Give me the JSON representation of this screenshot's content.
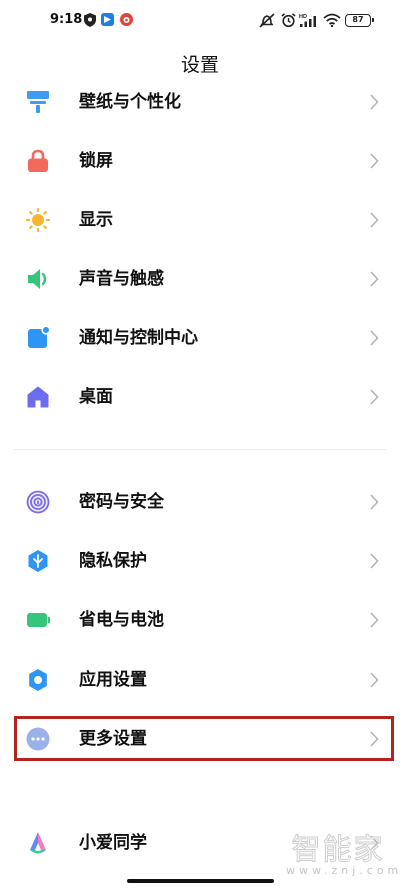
{
  "status_bar": {
    "time": "9:18",
    "network_label": "HD",
    "battery": "87"
  },
  "header": {
    "title": "设置"
  },
  "settings": {
    "items": [
      {
        "label": "壁纸与个性化",
        "icon": "wallpaper-icon",
        "color": "#3D9BF0"
      },
      {
        "label": "锁屏",
        "icon": "lock-icon",
        "color": "#F26A5B"
      },
      {
        "label": "显示",
        "icon": "sun-icon",
        "color": "#F5B731"
      },
      {
        "label": "声音与触感",
        "icon": "speaker-icon",
        "color": "#34C77B"
      },
      {
        "label": "通知与控制中心",
        "icon": "notification-icon",
        "color": "#2F95F2"
      },
      {
        "label": "桌面",
        "icon": "home-icon",
        "color": "#6C6CF0"
      },
      {
        "label": "密码与安全",
        "icon": "fingerprint-icon",
        "color": "#7B6CE8"
      },
      {
        "label": "隐私保护",
        "icon": "privacy-shield-icon",
        "color": "#2F95F2"
      },
      {
        "label": "省电与电池",
        "icon": "battery-icon",
        "color": "#34C77B"
      },
      {
        "label": "应用设置",
        "icon": "gear-icon",
        "color": "#2F95F2"
      },
      {
        "label": "更多设置",
        "icon": "more-icon",
        "color": "#9BB1E8"
      },
      {
        "label": "小爱同学",
        "icon": "xiaoai-icon",
        "color": "#5B8CF7"
      }
    ]
  },
  "watermark": {
    "text": "智能家",
    "url": "www.znj.com"
  },
  "highlight_color": "#B3241F"
}
